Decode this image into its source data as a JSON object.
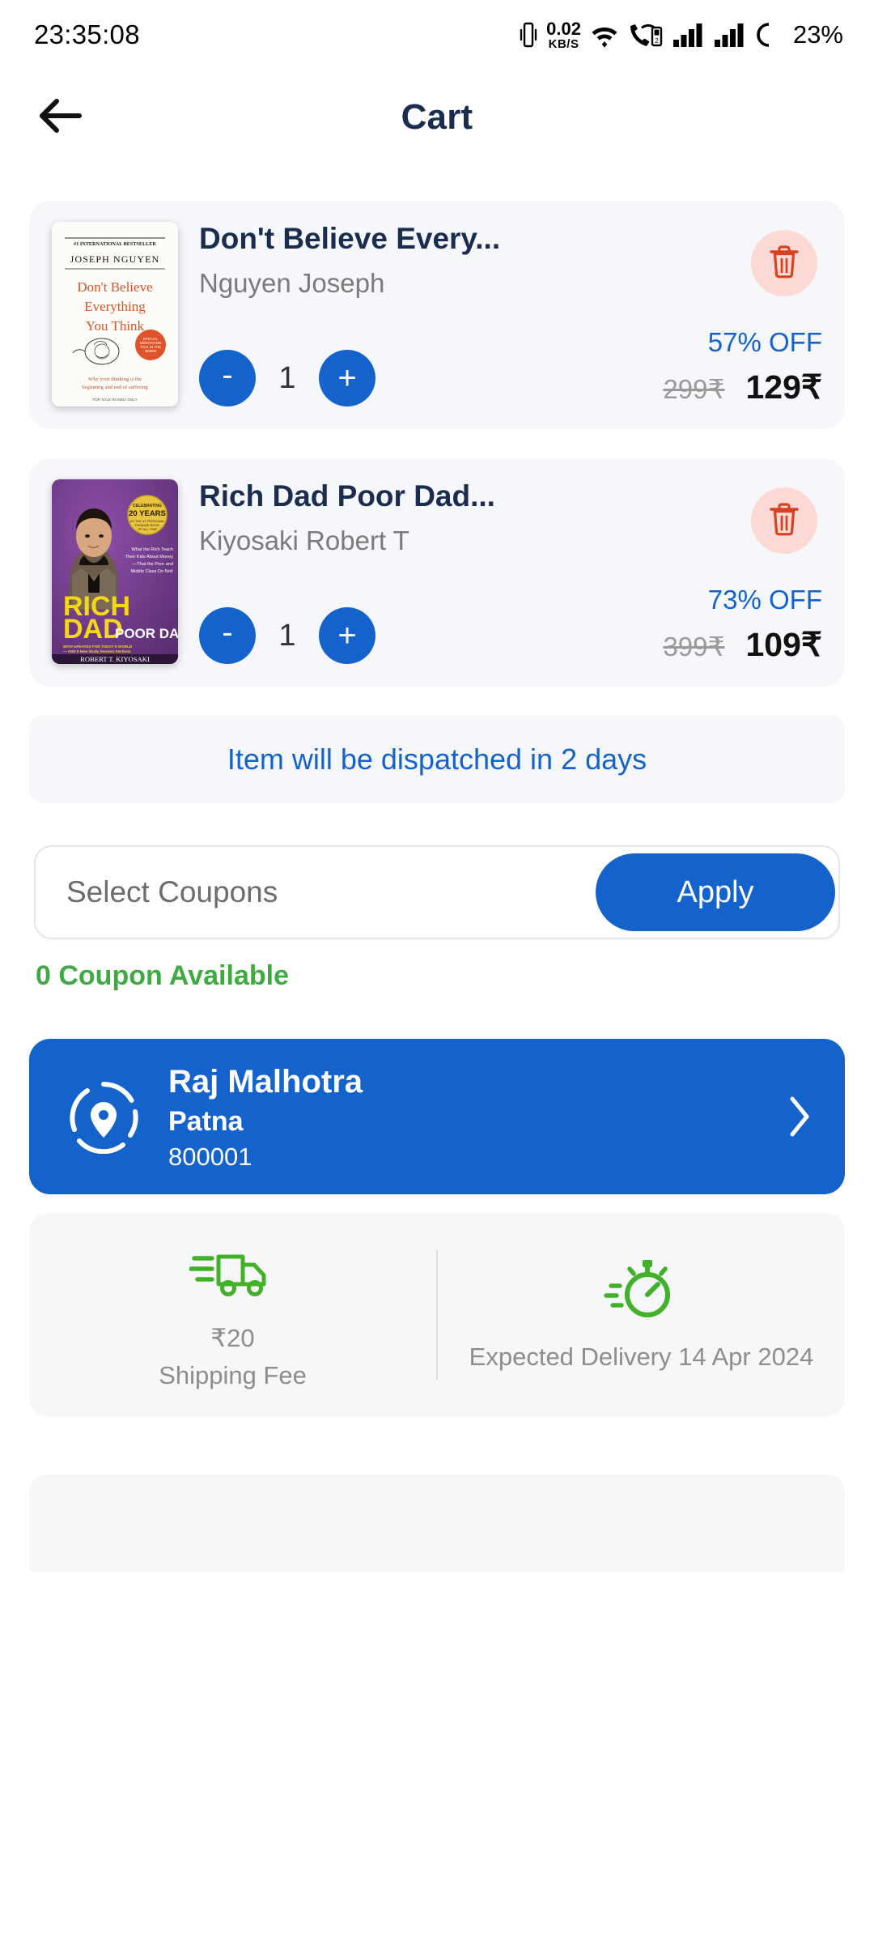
{
  "statusbar": {
    "time": "23:35:08",
    "net_speed_value": "0.02",
    "net_speed_unit": "KB/S",
    "battery_percent": "23%",
    "icons": [
      "vibrate-icon",
      "wifi-icon",
      "call-wifi-icon",
      "signal-bars-icon",
      "signal-bars-2-icon",
      "battery-ring-icon"
    ]
  },
  "header": {
    "title": "Cart",
    "back_icon": "arrow-left-icon"
  },
  "cart": {
    "items": [
      {
        "title": "Don't Believe Every...",
        "author": "Nguyen Joseph",
        "quantity": "1",
        "discount": "57% OFF",
        "mrp": "299₹",
        "price": "129₹",
        "minus_label": "-",
        "plus_label": "+",
        "delete_icon": "trash-icon",
        "cover": {
          "bestseller": "#1 INTERNATIONAL BESTSELLER",
          "author_line": "JOSEPH NGUYEN",
          "title_line1": "Don't Believe",
          "title_line2": "Everything",
          "title_line3": "You Think",
          "subtitle": "Why your thinking is the beginning and end of suffering",
          "footer": "FOR SALE IN INDIA ONLY"
        }
      },
      {
        "title": "Rich Dad Poor Dad...",
        "author": "Kiyosaki Robert T",
        "quantity": "1",
        "discount": "73% OFF",
        "mrp": "399₹",
        "price": "109₹",
        "minus_label": "-",
        "plus_label": "+",
        "delete_icon": "trash-icon",
        "cover": {
          "badge_line1": "CELEBRATING",
          "badge_line2": "20 YEARS",
          "badge_line3": "AS THE #1 PERSONAL FINANCE BOOK OF ALL TIME",
          "blurb": "What the Rich Teach Their Kids About Money —That the Poor and Middle Class Do Not!",
          "title_line1": "RICH",
          "title_line2": "DAD",
          "title_line3": "POOR DAD",
          "strap": "WITH UPDATES FOR TODAY'S WORLD — AND 9 New Study Session Sections",
          "author_line": "ROBERT T. KIYOSAKI"
        }
      }
    ]
  },
  "dispatch": {
    "message": "Item will be dispatched in 2 days"
  },
  "coupon": {
    "placeholder": "Select Coupons",
    "value": "",
    "apply_label": "Apply",
    "availability": "0 Coupon Available"
  },
  "address": {
    "name": "Raj Malhotra",
    "city": "Patna",
    "pincode": "800001",
    "location_icon": "location-pin-icon",
    "chevron_icon": "chevron-right-icon"
  },
  "shipping": {
    "fee_amount": "₹20",
    "fee_label": "Shipping Fee",
    "delivery_text": "Expected Delivery 14 Apr 2024",
    "truck_icon": "delivery-truck-icon",
    "stopwatch_icon": "stopwatch-icon"
  },
  "colors": {
    "primary_blue": "#1463cd",
    "navy": "#1b2d4f",
    "green": "#3faa42",
    "icon_green": "#43b02a",
    "delete_red": "#d8401f",
    "delete_bg": "#fcd9d4"
  }
}
